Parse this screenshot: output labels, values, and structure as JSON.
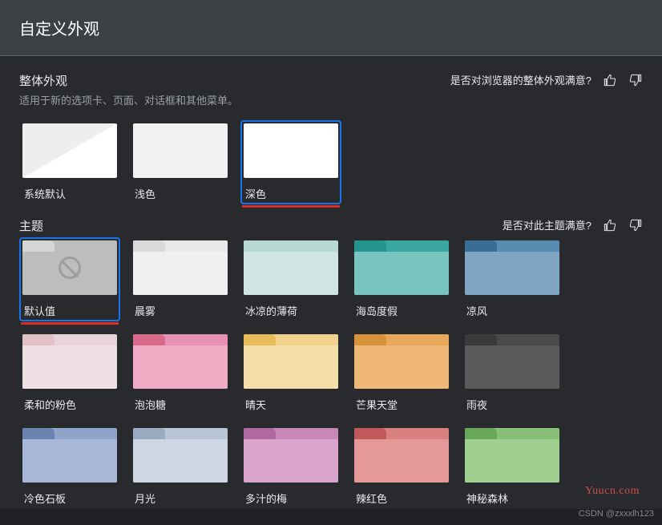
{
  "header": {
    "title": "自定义外观"
  },
  "sections": {
    "appearance": {
      "title": "整体外观",
      "subtitle": "适用于新的选项卡、页面、对话框和其他菜单。",
      "feedback": "是否对浏览器的整体外观满意?",
      "items": [
        {
          "label": "系统默认"
        },
        {
          "label": "浅色"
        },
        {
          "label": "深色"
        }
      ]
    },
    "themes": {
      "title": "主题",
      "feedback": "是否对此主题满意?",
      "items": [
        {
          "label": "默认值",
          "bg": "#bdbdbd",
          "tab": "#d6d6d6",
          "body": "#bdbdbd",
          "nosym": true
        },
        {
          "label": "晨雾",
          "bg": "#e8e8e8",
          "tab": "#d9d9d9",
          "body": "#f0f0f0"
        },
        {
          "label": "冰凉的薄荷",
          "bg": "#b9d9d4",
          "tab": "#b9d9d4",
          "body": "#cfe5e1"
        },
        {
          "label": "海岛度假",
          "bg": "#3aa6a0",
          "tab": "#24948e",
          "body": "#79c4c0"
        },
        {
          "label": "凉风",
          "bg": "#5a8bb0",
          "tab": "#3a6d95",
          "body": "#7ea6c2"
        },
        {
          "label": "柔和的粉色",
          "bg": "#e8d4d8",
          "tab": "#e0c2c8",
          "body": "#efdee2"
        },
        {
          "label": "泡泡糖",
          "bg": "#e891b5",
          "tab": "#d96a8c",
          "body": "#f0abc5"
        },
        {
          "label": "晴天",
          "bg": "#f0d28c",
          "tab": "#e8bc5a",
          "body": "#f5dfa8"
        },
        {
          "label": "芒果天堂",
          "bg": "#e8a85a",
          "tab": "#d8923a",
          "body": "#f0b878"
        },
        {
          "label": "雨夜",
          "bg": "#4a4a4a",
          "tab": "#3a3a3a",
          "body": "#5a5a5a"
        },
        {
          "label": "冷色石板",
          "bg": "#8fa4c8",
          "tab": "#6a82b0",
          "body": "#a8b8d8"
        },
        {
          "label": "月光",
          "bg": "#b8c4d4",
          "tab": "#9aaac0",
          "body": "#cdd6e2"
        },
        {
          "label": "多汁的梅",
          "bg": "#c888b8",
          "tab": "#b068a0",
          "body": "#d8a4cc"
        },
        {
          "label": "辣红色",
          "bg": "#d88080",
          "tab": "#c05a5a",
          "body": "#e49898"
        },
        {
          "label": "神秘森林",
          "bg": "#88c078",
          "tab": "#68a858",
          "body": "#a0d090"
        }
      ]
    }
  },
  "watermark": "Yuucn.com",
  "credit": "CSDN @zxxxlh123"
}
